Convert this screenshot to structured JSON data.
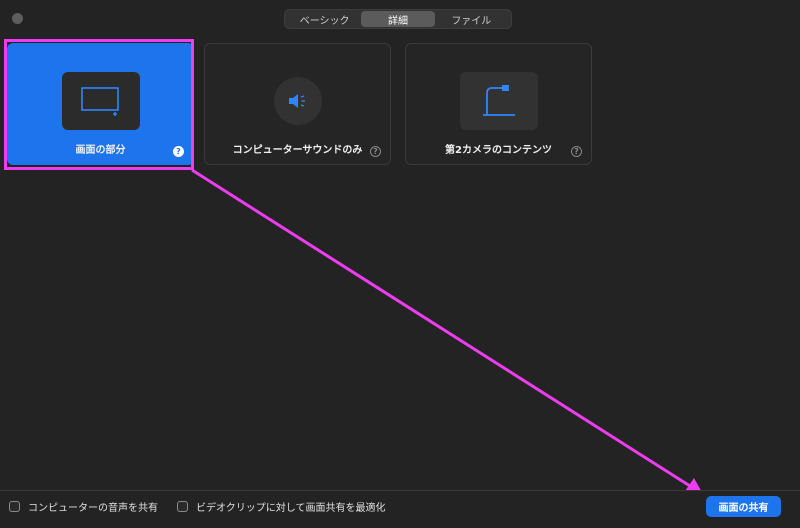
{
  "tabs": [
    {
      "label": "ベーシック",
      "active": false
    },
    {
      "label": "詳細",
      "active": true
    },
    {
      "label": "ファイル",
      "active": false
    }
  ],
  "options": [
    {
      "label": "画面の部分",
      "help": "?",
      "selected": true,
      "icon": "screen-region-icon"
    },
    {
      "label": "コンピューターサウンドのみ",
      "help": "?",
      "selected": false,
      "icon": "speaker-icon"
    },
    {
      "label": "第2カメラのコンテンツ",
      "help": "?",
      "selected": false,
      "icon": "document-camera-icon"
    }
  ],
  "footer": {
    "share_audio_label": "コンピューターの音声を共有",
    "optimize_video_label": "ビデオクリップに対して画面共有を最適化",
    "share_button_label": "画面の共有"
  },
  "colors": {
    "accent": "#1d74ec",
    "annotation": "#ee3df0",
    "background": "#232323"
  }
}
